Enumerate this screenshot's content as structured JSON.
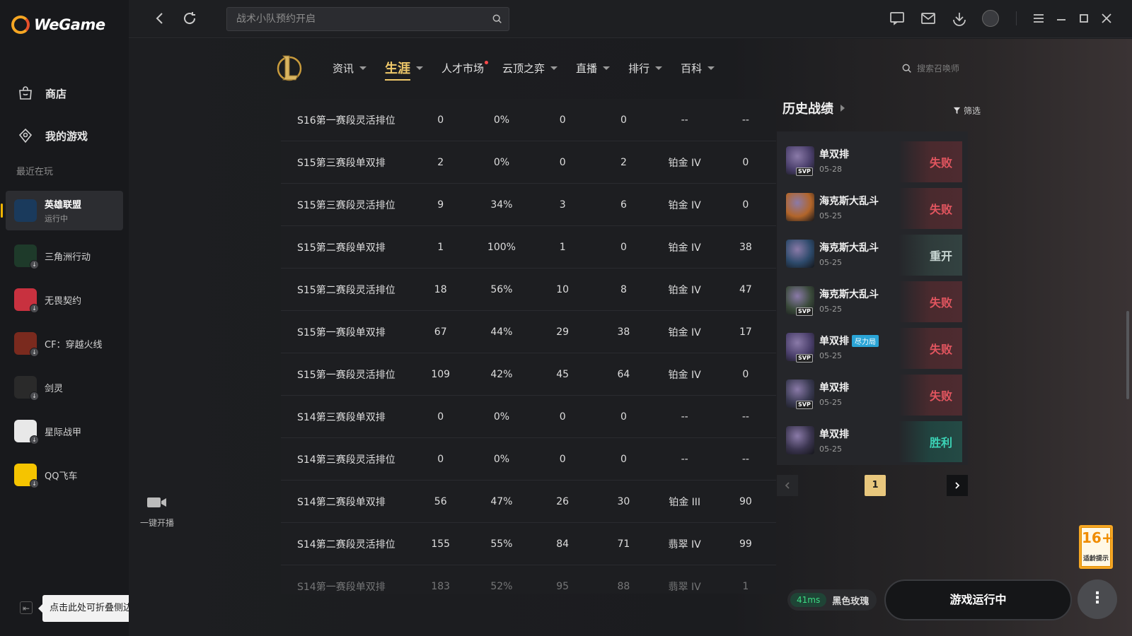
{
  "app": {
    "brand": "WeGame"
  },
  "sidebar": {
    "nav": [
      {
        "label": "商店",
        "icon": "store-icon"
      },
      {
        "label": "我的游戏",
        "icon": "controller-icon"
      }
    ],
    "recent_title": "最近在玩",
    "games": [
      {
        "name": "英雄联盟",
        "status": "运行中",
        "color": "#1a3a5c",
        "active": true
      },
      {
        "name": "三角洲行动",
        "status": "",
        "color": "#1e3a2a"
      },
      {
        "name": "无畏契约",
        "status": "",
        "color": "#c8313f"
      },
      {
        "name": "CF：穿越火线",
        "status": "",
        "color": "#7a2a1e"
      },
      {
        "name": "剑灵",
        "status": "",
        "color": "#2a2a2a"
      },
      {
        "name": "星际战甲",
        "status": "",
        "color": "#e8e8e8"
      },
      {
        "name": "QQ飞车",
        "status": "",
        "color": "#f5c400"
      }
    ],
    "collapse_tooltip": "点击此处可折叠侧边栏"
  },
  "topbar": {
    "search_placeholder": "战术小队预约开启"
  },
  "lol": {
    "tabs": [
      {
        "label": "资讯",
        "caret": true
      },
      {
        "label": "生涯",
        "caret": true,
        "active": true
      },
      {
        "label": "人才市场",
        "caret": false,
        "dot": true
      },
      {
        "label": "云顶之弈",
        "caret": true
      },
      {
        "label": "直播",
        "caret": true
      },
      {
        "label": "排行",
        "caret": true
      },
      {
        "label": "百科",
        "caret": true
      }
    ],
    "summoner_search_placeholder": "搜索召唤师"
  },
  "stream": {
    "label": "一键开播"
  },
  "ranked_table": {
    "rows": [
      [
        "S16第一赛段灵活排位",
        "0",
        "0%",
        "0",
        "0",
        "--",
        "--"
      ],
      [
        "S15第三赛段单双排",
        "2",
        "0%",
        "0",
        "2",
        "铂金 IV",
        "0"
      ],
      [
        "S15第三赛段灵活排位",
        "9",
        "34%",
        "3",
        "6",
        "铂金 IV",
        "0"
      ],
      [
        "S15第二赛段单双排",
        "1",
        "100%",
        "1",
        "0",
        "铂金 IV",
        "38"
      ],
      [
        "S15第二赛段灵活排位",
        "18",
        "56%",
        "10",
        "8",
        "铂金 IV",
        "47"
      ],
      [
        "S15第一赛段单双排",
        "67",
        "44%",
        "29",
        "38",
        "铂金 IV",
        "17"
      ],
      [
        "S15第一赛段灵活排位",
        "109",
        "42%",
        "45",
        "64",
        "铂金 IV",
        "0"
      ],
      [
        "S14第三赛段单双排",
        "0",
        "0%",
        "0",
        "0",
        "--",
        "--"
      ],
      [
        "S14第三赛段灵活排位",
        "0",
        "0%",
        "0",
        "0",
        "--",
        "--"
      ],
      [
        "S14第二赛段单双排",
        "56",
        "47%",
        "26",
        "30",
        "铂金 III",
        "90"
      ],
      [
        "S14第二赛段灵活排位",
        "155",
        "55%",
        "84",
        "71",
        "翡翠 IV",
        "99"
      ],
      [
        "S14第一赛段单双排",
        "183",
        "52%",
        "95",
        "88",
        "翡翠 IV",
        "1"
      ]
    ]
  },
  "history": {
    "title": "历史战绩",
    "filter_label": "筛选",
    "matches": [
      {
        "mode": "单双排",
        "date": "05-28",
        "result": "失败",
        "kind": "lose",
        "svp": true,
        "champ_color": "#4a3f6b"
      },
      {
        "mode": "海克斯大乱斗",
        "date": "05-25",
        "result": "失败",
        "kind": "lose",
        "svp": false,
        "champ_color": "#b2652a"
      },
      {
        "mode": "海克斯大乱斗",
        "date": "05-25",
        "result": "重开",
        "kind": "remake",
        "svp": false,
        "champ_color": "#2d4a6b"
      },
      {
        "mode": "海克斯大乱斗",
        "date": "05-25",
        "result": "失败",
        "kind": "lose",
        "svp": true,
        "champ_color": "#3a4a3a"
      },
      {
        "mode": "单双排",
        "date": "05-25",
        "result": "失败",
        "kind": "lose",
        "svp": true,
        "tag": "尽力局",
        "champ_color": "#4a3f6b"
      },
      {
        "mode": "单双排",
        "date": "05-25",
        "result": "失败",
        "kind": "lose",
        "svp": true,
        "champ_color": "#3a3a52"
      },
      {
        "mode": "单双排",
        "date": "05-25",
        "result": "胜利",
        "kind": "win",
        "svp": false,
        "champ_color": "#3b3550"
      }
    ],
    "page": "1"
  },
  "status": {
    "ping": "41ms",
    "server": "黑色玫瑰",
    "play_label": "游戏运行中",
    "more_label": "⋮",
    "age_rating": "16+",
    "age_note": "适龄提示"
  }
}
